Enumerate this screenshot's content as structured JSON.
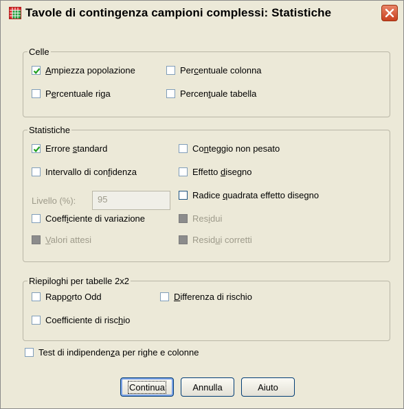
{
  "window": {
    "title": "Tavole di contingenza campioni complessi: Statistiche"
  },
  "celle": {
    "legend": "Celle",
    "items": [
      {
        "pre": "",
        "u": "A",
        "post": "mpiezza popolazione",
        "checked": true
      },
      {
        "pre": "Per",
        "u": "c",
        "post": "entuale colonna",
        "checked": false
      },
      {
        "pre": "P",
        "u": "e",
        "post": "rcentuale riga",
        "checked": false
      },
      {
        "pre": "Percen",
        "u": "t",
        "post": "uale tabella",
        "checked": false
      }
    ]
  },
  "statistiche": {
    "legend": "Statistiche",
    "items": [
      {
        "pre": "Errore ",
        "u": "s",
        "post": "tandard",
        "checked": true,
        "disabled": false
      },
      {
        "pre": "Co",
        "u": "n",
        "post": "teggio non pesato",
        "checked": false,
        "disabled": false
      },
      {
        "pre": "Intervallo di con",
        "u": "f",
        "post": "idenza",
        "checked": false,
        "disabled": false
      },
      {
        "pre": "Effetto ",
        "u": "d",
        "post": "isegno",
        "checked": false,
        "disabled": false
      },
      {
        "pre": "Radice ",
        "u": "q",
        "post": "uadrata effetto disegno",
        "checked": false,
        "disabled": false
      },
      {
        "pre": "Coeff",
        "u": "i",
        "post": "ciente di variazione",
        "checked": false,
        "disabled": false
      },
      {
        "pre": "Res",
        "u": "i",
        "post": "dui",
        "checked": false,
        "disabled": true
      },
      {
        "pre": "",
        "u": "V",
        "post": "alori attesi",
        "checked": false,
        "disabled": true
      },
      {
        "pre": "Resid",
        "u": "u",
        "post": "i corretti",
        "checked": false,
        "disabled": true
      }
    ],
    "livello_label": "Livello (%):",
    "livello_value": "95"
  },
  "riepiloghi": {
    "legend": "Riepiloghi per tabelle 2x2",
    "items": [
      {
        "pre": "Rapp",
        "u": "o",
        "post": "rto Odd",
        "checked": false
      },
      {
        "pre": "",
        "u": "D",
        "post": "ifferenza di rischio",
        "checked": false
      },
      {
        "pre": "Coefficiente di risc",
        "u": "h",
        "post": "io",
        "checked": false
      }
    ]
  },
  "test": {
    "pre": "Test di indipenden",
    "u": "z",
    "post": "a per righe e colonne",
    "checked": false
  },
  "buttons": {
    "continua": "Continua",
    "annulla": "Annulla",
    "aiuto": "Aiuto"
  },
  "colors": {
    "face": "#ece9d8",
    "check": "#21a121",
    "close": "#c8401f"
  }
}
